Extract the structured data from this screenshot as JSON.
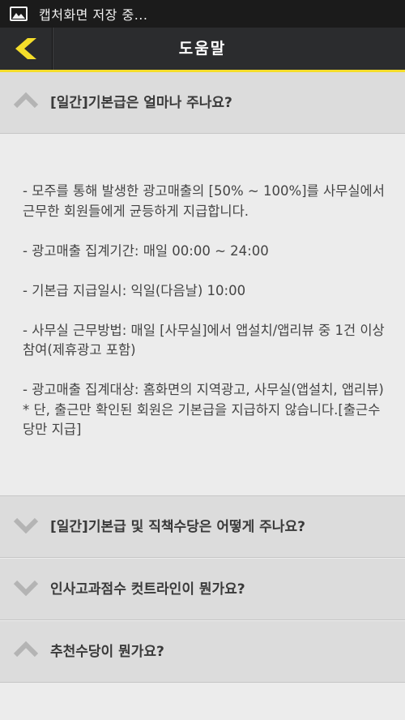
{
  "status_bar": {
    "notification_icon": "image-icon",
    "text": "캡처화면 저장 중..."
  },
  "header": {
    "back_icon": "chevron-left-icon",
    "title": "도움말",
    "accent_color": "#f4dd2a",
    "bar_color": "#2b2c2e"
  },
  "faq": {
    "items": [
      {
        "question": "[일간]기본급은 얼마나 주나요?",
        "expanded": true,
        "icon": "chevron-up-icon"
      },
      {
        "question": "[일간]기본급 및 직책수당은 어떻게 주나요?",
        "expanded": false,
        "icon": "chevron-down-icon"
      },
      {
        "question": "인사고과점수 컷트라인이 뭔가요?",
        "expanded": false,
        "icon": "chevron-down-icon"
      },
      {
        "question": "추천수당이 뭔가요?",
        "expanded": false,
        "icon": "chevron-up-icon"
      }
    ],
    "answer": {
      "paragraph_1": "- 모주를 통해 발생한 광고매출의 [50% ~ 100%]를 사무실에서 근무한 회원들에게 균등하게 지급합니다.",
      "paragraph_2": "- 광고매출 집계기간: 매일 00:00 ~ 24:00",
      "paragraph_3": "- 기본급 지급일시: 익일(다음날) 10:00",
      "paragraph_4": "- 사무실 근무방법: 매일 [사무실]에서 앱설치/앱리뷰 중 1건 이상 참여(제휴광고 포함)",
      "paragraph_5": "- 광고매출 집계대상: 홈화면의 지역광고, 사무실(앱설치, 앱리뷰)",
      "paragraph_6": "* 단, 출근만 확인된 회원은 기본급을 지급하지 않습니다.[출근수당만 지급]"
    }
  }
}
